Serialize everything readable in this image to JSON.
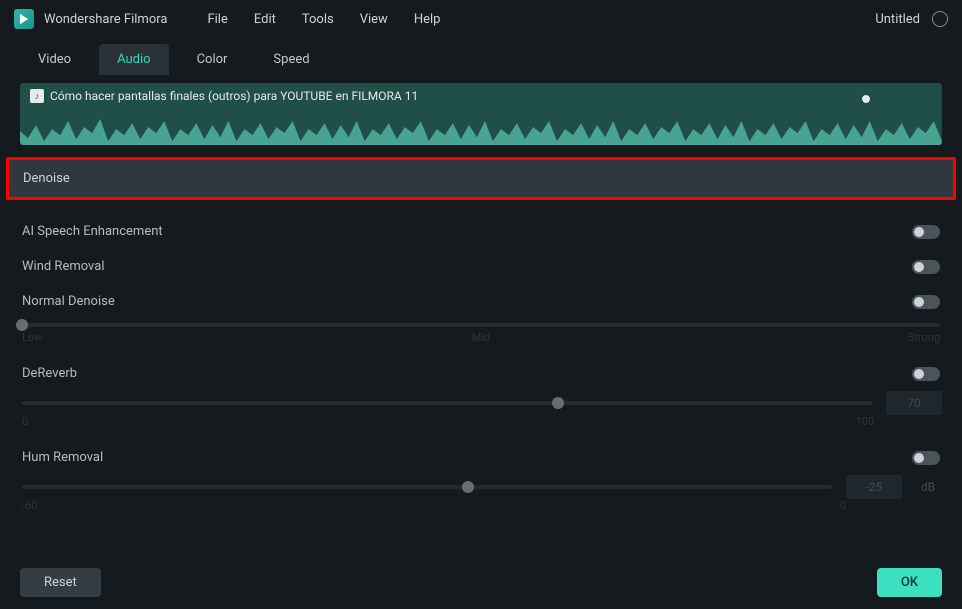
{
  "app_name": "Wondershare Filmora",
  "menus": [
    "File",
    "Edit",
    "Tools",
    "View",
    "Help"
  ],
  "project_title": "Untitled",
  "tabs": [
    {
      "label": "Video",
      "active": false
    },
    {
      "label": "Audio",
      "active": true
    },
    {
      "label": "Color",
      "active": false
    },
    {
      "label": "Speed",
      "active": false
    }
  ],
  "clip": {
    "title": "Cómo hacer pantallas finales (outros) para YOUTUBE en FILMORA 11"
  },
  "section": {
    "denoise_label": "Denoise"
  },
  "options": {
    "ai_speech": {
      "label": "AI Speech Enhancement",
      "on": false
    },
    "wind": {
      "label": "Wind Removal",
      "on": false
    },
    "normal": {
      "label": "Normal Denoise",
      "on": false,
      "slider": {
        "pos": 0,
        "labels": [
          "Low",
          "Mid",
          "Strong"
        ]
      }
    },
    "dereverb": {
      "label": "DeReverb",
      "on": false,
      "slider": {
        "pos": 63,
        "min": "0",
        "max": "100",
        "value": "70"
      }
    },
    "hum": {
      "label": "Hum Removal",
      "on": false,
      "slider": {
        "pos": 55,
        "min": "-60",
        "max": "0",
        "value": "-25",
        "unit": "dB"
      }
    }
  },
  "footer": {
    "reset": "Reset",
    "ok": "OK"
  }
}
